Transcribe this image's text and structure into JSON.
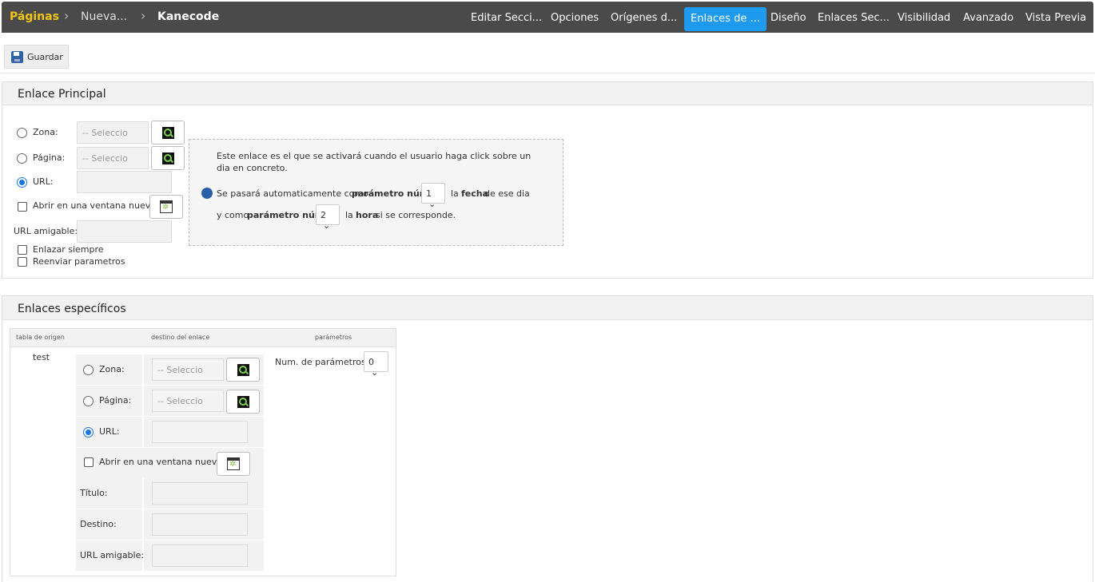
{
  "breadcrumb": [
    "Páginas",
    "Nueva...",
    "Kanecode"
  ],
  "nav_tabs": [
    "Editar Secci...",
    "Opciones",
    "Orígenes d...",
    "Enlaces de ...",
    "Diseño",
    "Enlaces Sec...",
    "Visibilidad",
    "Avanzado",
    "Vista Previa"
  ],
  "active_tab": "Enlaces de ...",
  "toolbar": {
    "save_label": "Guardar"
  },
  "principal": {
    "title": "Enlace Principal",
    "zona_label": "Zona:",
    "zona_placeholder": "-- Seleccio",
    "pagina_label": "Página:",
    "pagina_placeholder": "-- Seleccio",
    "url_label": "URL:",
    "url_value": "",
    "new_window_label": "Abrir en una ventana nueva.",
    "friendly_url_label": "URL amigable:",
    "enlazar_siempre": "Enlazar siempre",
    "reenviar_parametros": "Reenviar parametros",
    "selected_option": "URL",
    "info_text": "Este enlace es el que se activará cuando el usuario haga click sobre un dia en concreto.",
    "param_line1": {
      "prefix": "Se pasará automaticamente como",
      "bold": "parámetro núm.",
      "value": "1",
      "after": "la",
      "bold2": "fecha",
      "suffix": "de ese dia"
    },
    "param_line2": {
      "prefix": "y como",
      "bold": "parámetro núm.",
      "value": "2",
      "after": "la",
      "bold2": "hora",
      "suffix": "si se corresponde."
    }
  },
  "especificos": {
    "title": "Enlaces específicos",
    "headers": [
      "tabla de origen",
      "destino del enlace",
      "parámetros"
    ],
    "row": {
      "origin": "test",
      "zona_label": "Zona:",
      "zona_placeholder": "-- Seleccio",
      "pagina_label": "Página:",
      "pagina_placeholder": "-- Seleccio",
      "url_label": "URL:",
      "new_window_label": "Abrir en una ventana nueva.",
      "titulo_label": "Título:",
      "destino_label": "Destino:",
      "friendly_url_label": "URL amigable:",
      "num_params_label": "Num. de parámetros:",
      "num_params_value": "0",
      "selected_option": "URL"
    }
  },
  "colors": {
    "topbar": "#4a4a4a",
    "active_tab": "#1e9bf0",
    "breadcrumb_first": "#f2c417"
  }
}
